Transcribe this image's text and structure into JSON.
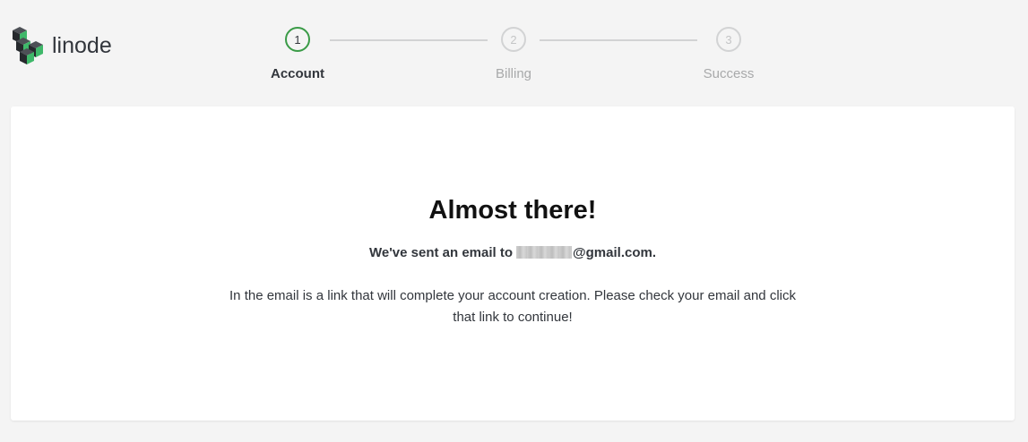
{
  "logo": {
    "text": "linode",
    "colors": {
      "green": "#3fb86a",
      "dark": "#32363c"
    }
  },
  "stepper": {
    "steps": [
      {
        "number": "1",
        "label": "Account",
        "state": "active"
      },
      {
        "number": "2",
        "label": "Billing",
        "state": "inactive"
      },
      {
        "number": "3",
        "label": "Success",
        "state": "inactive"
      }
    ],
    "colors": {
      "active": "#3a9b47",
      "inactive": "#d2d3d4"
    }
  },
  "card": {
    "title": "Almost there!",
    "sent_prefix": "We've sent an email to",
    "sent_suffix": "@gmail.com.",
    "instructions": "In the email is a link that will complete your account creation. Please check your email and click that link to continue!"
  }
}
